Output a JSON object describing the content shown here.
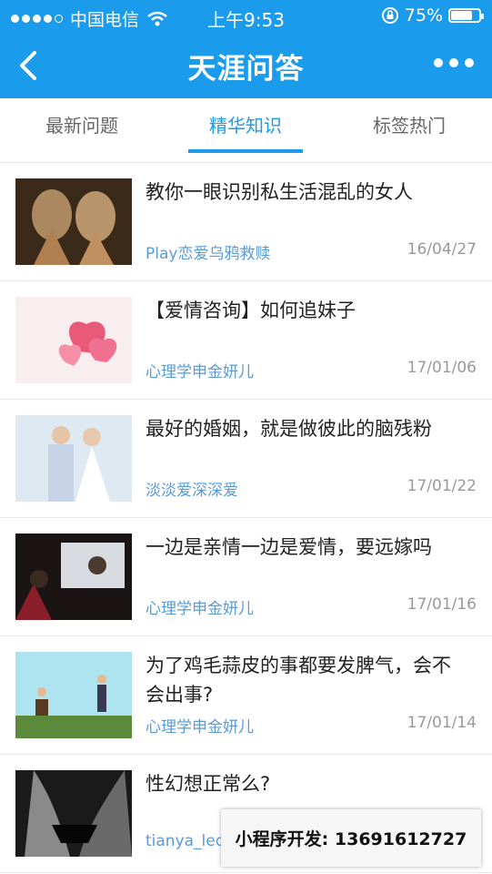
{
  "status": {
    "carrier": "中国电信",
    "time": "上午9:53",
    "battery": "75%",
    "battery_level": 0.75
  },
  "nav": {
    "title": "天涯问答"
  },
  "tabs": [
    {
      "label": "最新问题"
    },
    {
      "label": "精华知识",
      "active": true
    },
    {
      "label": "标签热门"
    }
  ],
  "items": [
    {
      "title": "教你一眼识别私生活混乱的女人",
      "author": "Play恋爱乌鸦救赎",
      "date": "16/04/27"
    },
    {
      "title": "【爱情咨询】如何追妹子",
      "author": "心理学申金妍儿",
      "date": "17/01/06"
    },
    {
      "title": "最好的婚姻，就是做彼此的脑残粉",
      "author": "淡淡爱深深爱",
      "date": "17/01/22"
    },
    {
      "title": "一边是亲情一边是爱情，要远嫁吗",
      "author": "心理学申金妍儿",
      "date": "17/01/16"
    },
    {
      "title": "为了鸡毛蒜皮的事都要发脾气，会不会出事?",
      "author": "心理学申金妍儿",
      "date": "17/01/14"
    },
    {
      "title": "性幻想正常么?",
      "author": "tianya_leo",
      "date": ""
    }
  ],
  "ad": {
    "text": "小程序开发:  13691612727"
  },
  "colors": {
    "primary": "#1a9bec",
    "author": "#5b9bd5",
    "date": "#999999"
  }
}
